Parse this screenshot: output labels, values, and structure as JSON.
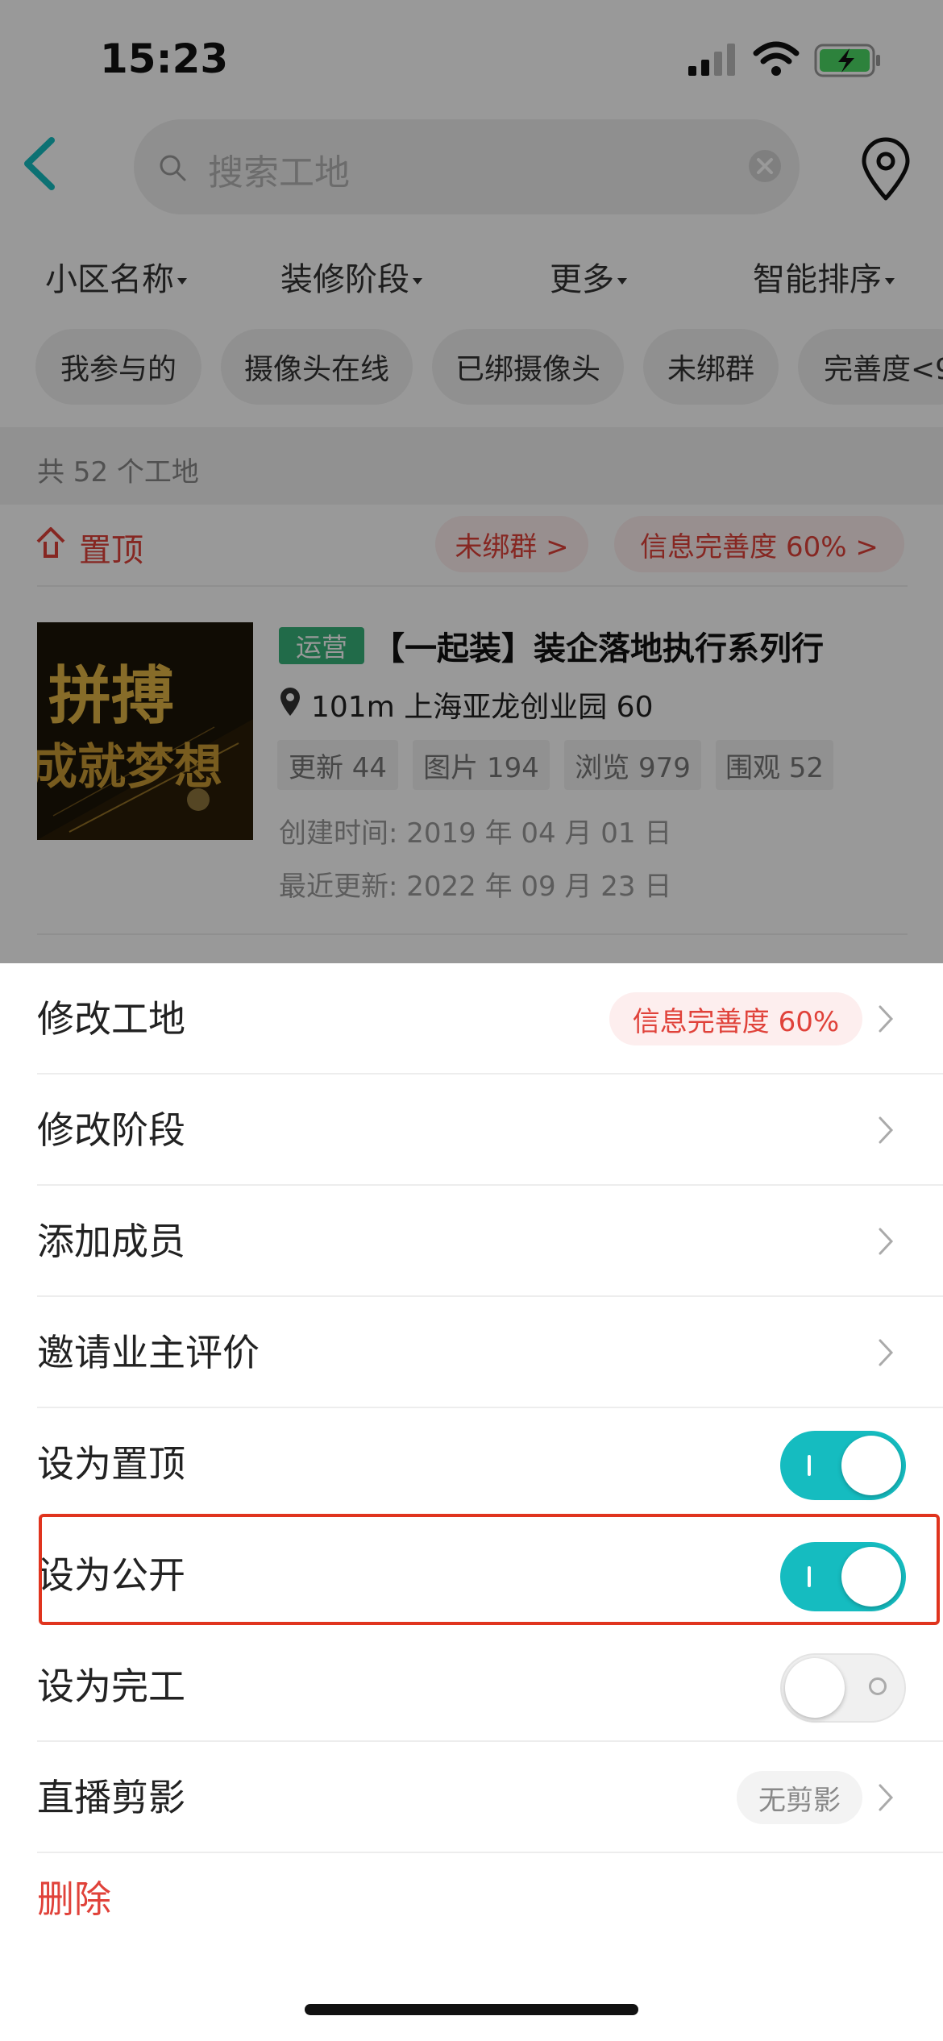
{
  "status_bar": {
    "time": "15:23"
  },
  "search": {
    "placeholder": "搜索工地"
  },
  "filters": [
    "小区名称",
    "装修阶段",
    "更多",
    "智能排序"
  ],
  "chips": [
    "我参与的",
    "摄像头在线",
    "已绑摄像头",
    "未绑群",
    "完善度<9"
  ],
  "summary": {
    "count_text": "共 52 个工地"
  },
  "pinned": {
    "label": "置顶",
    "tag_unbound": "未绑群 >",
    "tag_completeness": "信息完善度 60% >"
  },
  "card": {
    "thumb_text_1": "拼搏",
    "thumb_text_2": "成就梦想",
    "badge": "运营",
    "title": "【一起装】装企落地执行系列行",
    "address": "101m  上海亚龙创业园  60",
    "stats": [
      "更新 44",
      "图片 194",
      "浏览 979",
      "围观 52"
    ],
    "created": "创建时间:  2019 年 04 月 01 日",
    "updated": "最近更新:  2022 年 09 月 23 日"
  },
  "sheet": {
    "items": [
      {
        "label": "修改工地",
        "pill": "信息完善度 60%",
        "type": "link"
      },
      {
        "label": "修改阶段",
        "type": "link"
      },
      {
        "label": "添加成员",
        "type": "link"
      },
      {
        "label": "邀请业主评价",
        "type": "link"
      },
      {
        "label": "设为置顶",
        "type": "toggle",
        "on": true
      },
      {
        "label": "设为公开",
        "type": "toggle",
        "on": true
      },
      {
        "label": "设为完工",
        "type": "toggle",
        "on": false
      },
      {
        "label": "直播剪影",
        "pill": "无剪影",
        "type": "link"
      }
    ],
    "delete_label": "删除"
  },
  "colors": {
    "accent": "#15bcc0",
    "danger": "#e0423a",
    "highlight_box": "#e0341e"
  }
}
